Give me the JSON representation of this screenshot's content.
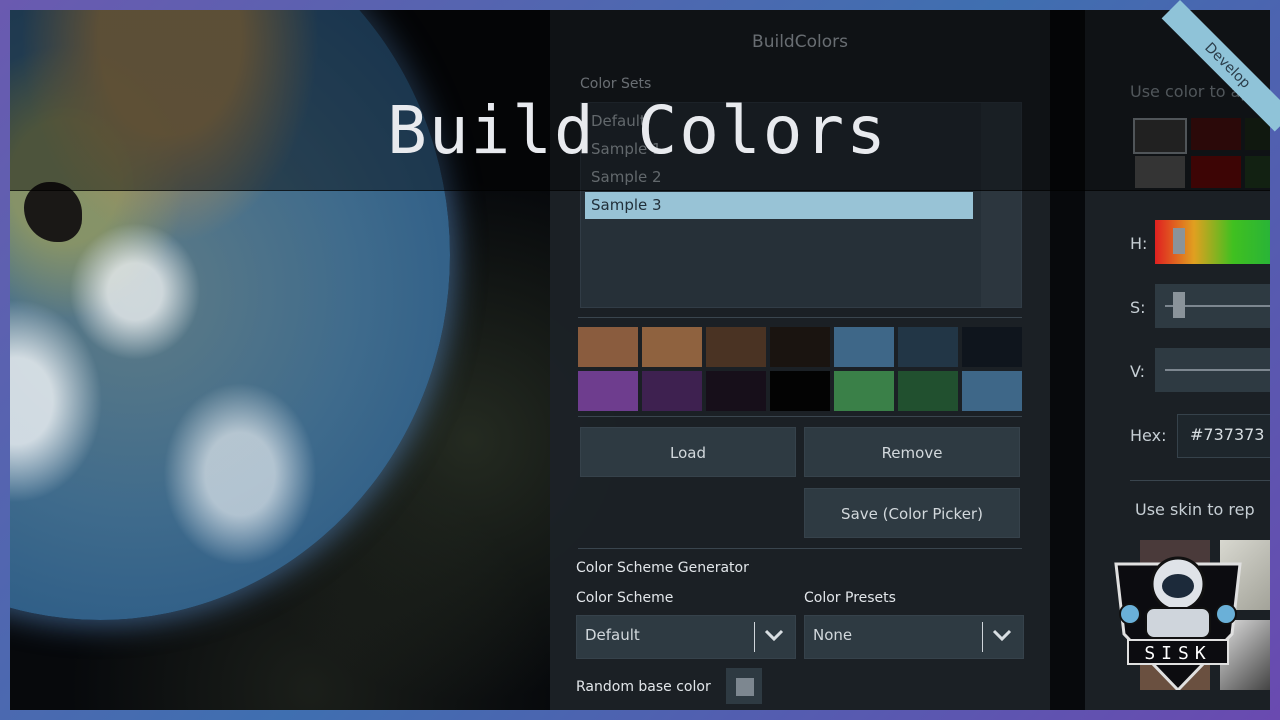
{
  "banner": {
    "title": "Build Colors"
  },
  "ribbon": {
    "label": "Develop"
  },
  "build_colors_panel": {
    "title": "BuildColors",
    "color_sets_label": "Color Sets",
    "color_sets": [
      "Default",
      "Sample 1",
      "Sample 2",
      "Sample 3"
    ],
    "selected_index": 3,
    "swatches": [
      "#8a5c3e",
      "#8f623f",
      "#4a3323",
      "#1a1410",
      "#3e6788",
      "#223646",
      "#0f151d",
      "#6e3d8e",
      "#3e2150",
      "#170f1a",
      "#030303",
      "#3a8048",
      "#21502f",
      "#3e6788"
    ],
    "load_label": "Load",
    "remove_label": "Remove",
    "save_label": "Save (Color Picker)",
    "generator_label": "Color Scheme Generator",
    "scheme_label": "Color Scheme",
    "scheme_value": "Default",
    "presets_label": "Color Presets",
    "presets_value": "None",
    "random_base_label": "Random base color"
  },
  "color_picker_panel": {
    "use_color_label": "Use color to ap",
    "swatches_row1": [
      "#3a3a3a",
      "#4a1010",
      "#1c2a1a"
    ],
    "swatches_row2": [
      "#5a5a5a",
      "#6a0a0a",
      "#1f3a1f"
    ],
    "h_label": "H:",
    "s_label": "S:",
    "v_label": "V:",
    "hex_label": "Hex:",
    "hex_value": "#737373",
    "use_skin_label": "Use skin to rep"
  },
  "logo": {
    "text": "SISK"
  }
}
